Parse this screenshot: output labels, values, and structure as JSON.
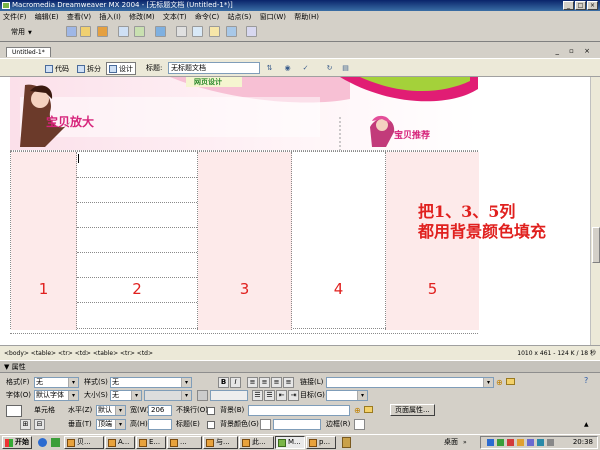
{
  "window": {
    "title": "Macromedia Dreamweaver MX 2004 - [无标题文档 (Untitled-1*)]"
  },
  "menu": [
    "文件(F)",
    "编辑(E)",
    "查看(V)",
    "插入(I)",
    "修改(M)",
    "文本(T)",
    "命令(C)",
    "站点(S)",
    "窗口(W)",
    "帮助(H)"
  ],
  "insertbar": {
    "category": "常用"
  },
  "document": {
    "tab": "Untitled-1*",
    "views": {
      "code": "代码",
      "split": "拆分",
      "design": "设计"
    },
    "title_label": "标题:",
    "title_value": "无标题文档"
  },
  "banner": {
    "left_text": "宝贝放大",
    "right_text": "宝贝推荐",
    "top_text": "网页设计"
  },
  "table": {
    "columns": [
      "1",
      "2",
      "3",
      "4",
      "5"
    ]
  },
  "annotation": {
    "line1": "把1、3、5列",
    "line2": "都用背景颜色填充"
  },
  "status": {
    "tag_selector": "<body> <table> <tr> <td> <table> <tr> <td>",
    "size_info": "1010 x 461 - 124 K / 18 秒"
  },
  "properties": {
    "panel_title": "▼ 属性",
    "format_label": "格式(F)",
    "format_value": "无",
    "style_label": "样式(S)",
    "style_value": "无",
    "font_label": "字体(O)",
    "font_value": "默认字体",
    "size_label": "大小(S)",
    "size_value": "无",
    "link_label": "链接(L)",
    "target_label": "目标(G)",
    "cell_label": "单元格",
    "horz_label": "水平(Z)",
    "horz_value": "默认",
    "width_label": "宽(W)",
    "width_value": "206",
    "nowrap_label": "不换行(O)",
    "bg_label": "背景(B)",
    "page_props_button": "页面属性...",
    "vert_label": "垂直(T)",
    "vert_value": "顶端",
    "height_label": "高(H)",
    "height_value": "",
    "header_label": "标题(E)",
    "bgcolor_label": "背景颜色(G)",
    "border_label": "边框(R)",
    "bold": "B",
    "italic": "I"
  },
  "taskbar": {
    "start": "开始",
    "tasks": [
      "贝...",
      "A...",
      "E...",
      "...",
      "与...",
      "此...",
      "M...",
      "p..."
    ],
    "tray_label": "桌面",
    "clock": "20:38"
  },
  "colors": {
    "highlight_column": "#fdeaea",
    "annotation_text": "#e0201e"
  }
}
